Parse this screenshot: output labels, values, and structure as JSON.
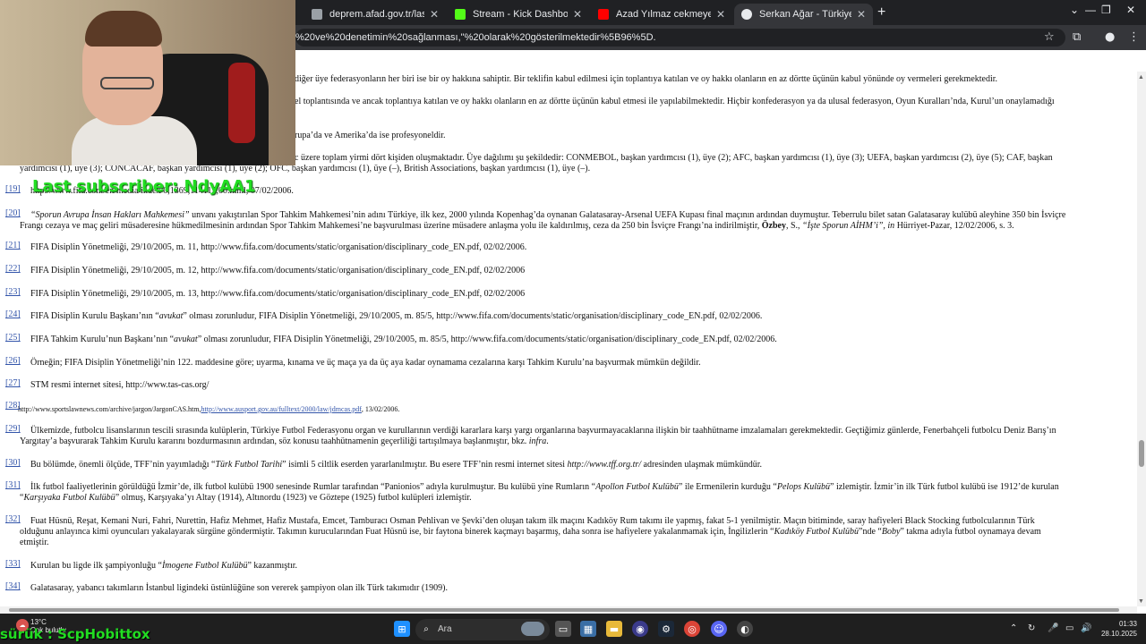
{
  "browser": {
    "tabs": [
      {
        "label": "deprem.afad.gov.tr/last-earthq",
        "color": "#e8eaed"
      },
      {
        "label": "Stream - Kick Dashboard",
        "color": "#53fc18"
      },
      {
        "label": "Azad Yılmaz cekmeyen telefon",
        "color": "#ff0000"
      },
      {
        "label": "Serkan Ağar - Türkiye Futbol Fe",
        "color": "#e8eaed"
      }
    ],
    "url": "%20ve%20denetimin%20sağlanması,\"%20olarak%20gösterilmektedir%5B96%5D."
  },
  "overlay": {
    "last_subscriber": "Last subscriber: NdyAA1",
    "bottom_left": "sürük : ScpHobittox"
  },
  "page": {
    "lines": {
      "l0": "diğer üye federasyonların her biri ise bir oy hakkına sahiptir. Bir teklifin kabul edilmesi için toplantıya katılan ve oy hakkı olanların en az dörtte üçünün kabul yönünde oy vermeleri gerekmektedir.",
      "l1": "el toplantısında ve ancak toplantıya katılan ve oy hakkı olanların en az dörtte üçünün kabul etmesi ile yapılabilmektedir. Hiçbir konfederasyon ya da ulusal federasyon, Oyun Kuralları’nda, Kurul’un onaylamadığı",
      "l2": "rupa’da ve Amerika’da ise profesyoneldir.",
      "l3a": "c üzere toplam yirmi dört kişiden oluşmaktadır. Üye dağılımı şu şekildedir: CONMEBOL, başkan yardımcısı (1), üye (2); AFC, başkan yardımcısı (1), üye (3); UEFA, başkan yardımcısı (2), üye (5); CAF, başkan",
      "l3b": "yardımcısı (1), üye (3); CONCACAF, başkan yardımcısı (1), üye (2); OFC, başkan yardımcısı (1), üye (–), British Associations, başkan yardımcısı (1), üye (–)."
    },
    "footnotes": [
      {
        "ref": "[19]",
        "text": "http://www.fifa.com/en/media/index/0,1369,114113,00.html, 07/02/2006."
      },
      {
        "ref": "[20]",
        "i1": "“Sporun Avrupa İnsan Hakları Mahkemesi”",
        "t1": " unvanı yakıştırılan Spor Tahkim Mahkemesi’nin adını Türkiye, ilk kez, 2000 yılında Kopenhag’da oynanan Galatasaray-Arsenal UEFA Kupası final maçının ardından duymuştur. Teberrulu bilet satan Galatasaray kulübü aleyhine 350 bin İsviçre",
        "t2": "Frangı cezaya ve maç geliri müsaderesine hükmedilmesinin ardından Spor Tahkim Mahkemesi’ne başvurulması üzerine müsadere anlaşma yolu ile kaldırılmış, ceza da 250 bin İsviçre Frangı’na indirilmiştir, ",
        "b": "Özbey",
        "t3": ", S., ",
        "i2": "“İşte Sporun AİHM’i”, in",
        "t4": " Hürriyet-Pazar, 12/02/2006, s. 3."
      },
      {
        "ref": "[21]",
        "text": "FIFA Disiplin Yönetmeliği, 29/10/2005, m. 11,  http://www.fifa.com/documents/static/organisation/disciplinary_code_EN.pdf, 02/02/2006."
      },
      {
        "ref": "[22]",
        "text": "FIFA Disiplin Yönetmeliği, 29/10/2005, m. 12,  http://www.fifa.com/documents/static/organisation/disciplinary_code_EN.pdf, 02/02/2006"
      },
      {
        "ref": "[23]",
        "text": "FIFA Disiplin Yönetmeliği, 29/10/2005, m. 13,  http://www.fifa.com/documents/static/organisation/disciplinary_code_EN.pdf, 02/02/2006"
      },
      {
        "ref": "[24]",
        "t1": "FIFA Disiplin Kurulu Başkanı’nın “",
        "i1": "avukat",
        "t2": "” olması zorunludur, FIFA Disiplin Yönetmeliği, 29/10/2005, m. 85/5,  http://www.fifa.com/documents/static/organisation/disciplinary_code_EN.pdf, 02/02/2006."
      },
      {
        "ref": "[25]",
        "t1": "FIFA Tahkim Kurulu’nun Başkanı’nın “",
        "i1": "avukat",
        "t2": "” olması zorunludur, FIFA Disiplin Yönetmeliği, 29/10/2005, m. 85/5,  http://www.fifa.com/documents/static/organisation/disciplinary_code_EN.pdf, 02/02/2006."
      },
      {
        "ref": "[26]",
        "text": "Örneğin; FIFA Disiplin Yönetmeliği’nin 122. maddesine göre; uyarma, kınama ve üç maça ya da üç aya kadar oynamama cezalarına karşı Tahkim Kurulu’na başvurmak mümkün değildir."
      },
      {
        "ref": "[27]",
        "text": "STM resmi internet sitesi, http://www.tas-cas.org/"
      },
      {
        "ref": "[28]",
        "t1": "http://www.sportslawnews.com/archive/jargon/JargonCAS.htm,",
        "link": "http://www.ausport.gov.au/fulltext/2000/law/jdmcas.pdf",
        "t2": ", 13/02/2006."
      },
      {
        "ref": "[29]",
        "t1": "Ülkemizde, futbolcu lisanslarının tescili sırasında kulüplerin, Türkiye Futbol Federasyonu organ ve kurullarının verdiği kararlara karşı yargı organlarına başvurmayacaklarına ilişkin bir taahhütname imzalamaları gerekmektedir. Geçtiğimiz günlerde, Fenerbahçeli futbolcu Deniz Barış’ın",
        "t2": "Yargıtay’a başvurarak Tahkim Kurulu kararını bozdurmasının ardından, söz konusu taahhütnamenin geçerliliği tartışılmaya başlanmıştır, bkz. ",
        "i1": "infra",
        "t3": "."
      },
      {
        "ref": "[30]",
        "t1": "Bu bölümde, önemli ölçüde, TFF’nin yayımladığı “",
        "i1": "Türk Futbol Tarihi",
        "t2": "” isimli 5 ciltlik eserden yararlanılmıştır. Bu esere TFF’nin resmi internet sitesi ",
        "i2": "http://www.tff.org.tr/",
        "t3": " adresinden ulaşmak mümkündür."
      },
      {
        "ref": "[31]",
        "t1": "İlk futbol faaliyetlerinin görüldüğü İzmir’de, ilk futbol kulübü 1900 senesinde Rumlar tarafından “Panionios” adıyla kurulmuştur. Bu kulübü yine Rumların “",
        "i1": "Apollon Futbol Kulübü",
        "t2": "” ile Ermenilerin kurduğu “",
        "i2": "Pelops Kulübü",
        "t3": "” izlemiştir. İzmir’in ilk Türk futbol kulübü ise 1912’de kurulan",
        "t4": "“",
        "i3": "Karşıyaka Futbol Kulübü",
        "t5": "” olmuş, Karşıyaka’yı Altay (1914), Altınordu (1923) ve Göztepe (1925) futbol kulüpleri izlemiştir."
      },
      {
        "ref": "[32]",
        "t1": "Fuat Hüsnü, Reşat, Kemani Nuri, Fahri, Nurettin, Hafiz Mehmet, Hafiz Mustafa, Emcet, Tamburacı Osman Pehlivan ve Şevki’den oluşan takım ilk maçını Kadıköy Rum takımı ile yapmış, fakat 5-1 yenilmiştir. Maçın bitiminde, saray hafiyeleri Black Stocking futbolcularının Türk",
        "t2": "olduğunu anlayınca kimi oyuncuları yakalayarak sürgüne göndermiştir. Takımın kurucularından Fuat Hüsnü ise, bir faytona binerek kaçmayı başarmış, daha sonra ise hafiyelere yakalanmamak için, İngilizlerin “",
        "i1": "Kadıköy Futbol Kulübü",
        "t3": "”nde “",
        "i2": "Boby",
        "t4": "” takma adıyla futbol oynamaya devam",
        "t5": "etmiştir."
      },
      {
        "ref": "[33]",
        "t1": "Kurulan bu ligde ilk şampiyonluğu “",
        "i1": "İmogene Futbol Kulübü",
        "t2": "” kazanmıştır."
      },
      {
        "ref": "[34]",
        "text": "Galatasaray, yabancı takımların İstanbul ligindeki üstünlüğüne son vererek şampiyon olan ilk Türk takımıdır (1909)."
      }
    ]
  },
  "taskbar": {
    "weather_temp": "13°C",
    "weather_desc": "Çok bulutlu",
    "search_label": "Ara",
    "time": "01:33",
    "date": "28.10.2025"
  },
  "colors": {
    "chrome_dark": "#202124",
    "chrome_tab_active": "#35363a",
    "link": "#3355aa",
    "overlay_green": "#22dd22",
    "taskbar": "#1f1f1f"
  }
}
